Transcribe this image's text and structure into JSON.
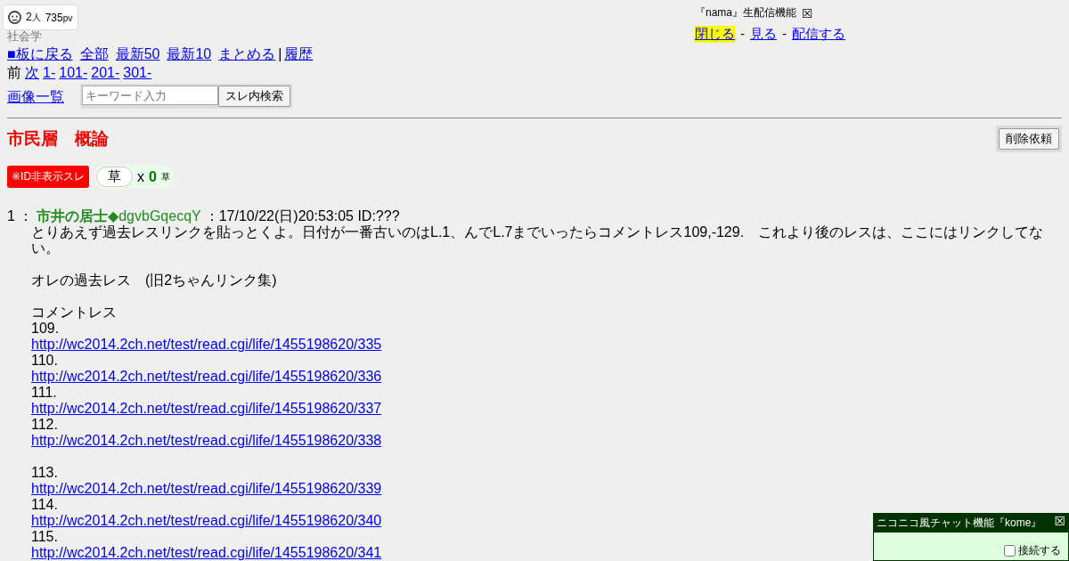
{
  "counter": {
    "people": "2",
    "people_unit": "人",
    "views": "735",
    "views_unit": "pv"
  },
  "category": "社会学",
  "nav": {
    "links": [
      {
        "label": "■板に戻る"
      },
      {
        "label": "全部"
      },
      {
        "label": "最新50"
      },
      {
        "label": "最新10"
      },
      {
        "label": "まとめる"
      }
    ],
    "separator": "|",
    "history": "履歴"
  },
  "pager": {
    "prev": "前",
    "links": [
      {
        "label": "次"
      },
      {
        "label": "1-"
      },
      {
        "label": "101-"
      },
      {
        "label": "201-"
      },
      {
        "label": "301-"
      }
    ]
  },
  "images_link": "画像一覧",
  "search": {
    "placeholder": "キーワード入力",
    "button": "スレ内検索"
  },
  "nama": {
    "title": "『nama』生配信機能",
    "close": "☒",
    "links": [
      {
        "label": "閉じる",
        "selected": true
      },
      {
        "label": "見る",
        "selected": false
      },
      {
        "label": "配信する",
        "selected": false
      }
    ],
    "separator": "-"
  },
  "thread": {
    "title": "市民層　概論",
    "delete_button": "削除依頼",
    "badge": "※ID非表示スレ",
    "kusa_button": "草",
    "kusa_x": "x",
    "kusa_count": "0",
    "kusa_unit": "草"
  },
  "post": {
    "number": "1",
    "colon": "：",
    "name": "市井の居士",
    "trip": "◆dgvbGqecqY",
    "meta": "：17/10/22(日)20:53:05 ID:???",
    "body": [
      {
        "kind": "text",
        "text": "とりあえず過去レスリンクを貼っとくよ。日付が一番古いのはL.1、んでL.7までいったらコメントレス109,-129.　これより後のレスは、ここにはリンクしてない。"
      },
      {
        "kind": "gap"
      },
      {
        "kind": "text",
        "text": "オレの過去レス　(旧2ちゃんリンク集)"
      },
      {
        "kind": "gap"
      },
      {
        "kind": "text",
        "text": "コメントレス"
      },
      {
        "kind": "text",
        "text": "109."
      },
      {
        "kind": "link",
        "text": "http://wc2014.2ch.net/test/read.cgi/life/1455198620/335"
      },
      {
        "kind": "text",
        "text": "110."
      },
      {
        "kind": "link",
        "text": "http://wc2014.2ch.net/test/read.cgi/life/1455198620/336"
      },
      {
        "kind": "text",
        "text": "111."
      },
      {
        "kind": "link",
        "text": "http://wc2014.2ch.net/test/read.cgi/life/1455198620/337"
      },
      {
        "kind": "text",
        "text": "112."
      },
      {
        "kind": "link",
        "text": "http://wc2014.2ch.net/test/read.cgi/life/1455198620/338"
      },
      {
        "kind": "gap"
      },
      {
        "kind": "text",
        "text": "113."
      },
      {
        "kind": "link",
        "text": "http://wc2014.2ch.net/test/read.cgi/life/1455198620/339"
      },
      {
        "kind": "text",
        "text": "114."
      },
      {
        "kind": "link",
        "text": "http://wc2014.2ch.net/test/read.cgi/life/1455198620/340"
      },
      {
        "kind": "text",
        "text": "115."
      },
      {
        "kind": "link",
        "text": "http://wc2014.2ch.net/test/read.cgi/life/1455198620/341"
      }
    ]
  },
  "chat": {
    "title": "ニコニコ風チャット機能『kome』",
    "close": "☒",
    "connect": {
      "label": "接続する",
      "checked": false
    }
  }
}
